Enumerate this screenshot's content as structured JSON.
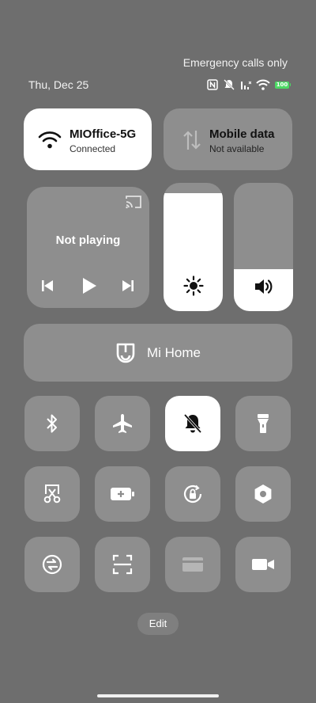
{
  "status_bar": {
    "emergency": "Emergency calls only",
    "date": "Thu, Dec 25",
    "battery": "100",
    "icons": [
      "nfc-icon",
      "mute-icon",
      "signal-icon",
      "wifi-icon",
      "battery-icon"
    ]
  },
  "wifi": {
    "name": "MIOffice-5G",
    "status": "Connected"
  },
  "mobile_data": {
    "title": "Mobile data",
    "status": "Not available"
  },
  "media": {
    "title": "Not playing"
  },
  "sliders": {
    "brightness": 0.92,
    "volume": 0.33
  },
  "mi_home": {
    "label": "Mi Home"
  },
  "tiles": [
    {
      "name": "bluetooth",
      "icon": "bluetooth-icon",
      "active": false
    },
    {
      "name": "airplane-mode",
      "icon": "airplane-icon",
      "active": false
    },
    {
      "name": "silent-mode",
      "icon": "bell-off-icon",
      "active": true
    },
    {
      "name": "flashlight",
      "icon": "flashlight-icon",
      "active": false
    },
    {
      "name": "screenshot",
      "icon": "scissors-icon",
      "active": false
    },
    {
      "name": "battery-saver",
      "icon": "battery-plus-icon",
      "active": false
    },
    {
      "name": "rotation-lock",
      "icon": "rotation-lock-icon",
      "active": false
    },
    {
      "name": "settings",
      "icon": "hexagon-icon",
      "active": false
    },
    {
      "name": "mi-share",
      "icon": "share-circle-icon",
      "active": false
    },
    {
      "name": "scanner",
      "icon": "scan-icon",
      "active": false
    },
    {
      "name": "card",
      "icon": "card-icon",
      "active": false,
      "disabled": true
    },
    {
      "name": "video-toolbox",
      "icon": "video-icon",
      "active": false
    }
  ],
  "edit_label": "Edit",
  "colors": {
    "background": "#6e6e6e",
    "tile": "#8e8e8e",
    "active": "#ffffff",
    "battery": "#4cd964"
  }
}
